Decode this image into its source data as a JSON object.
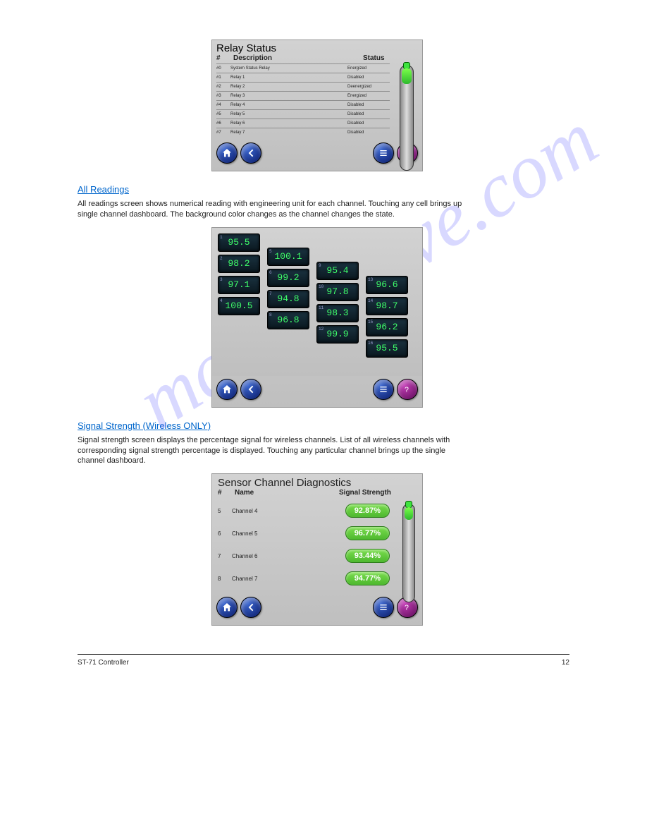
{
  "watermark": "manualslive.com",
  "relay": {
    "title": "Relay Status",
    "headers": {
      "num": "#",
      "desc": "Description",
      "status": "Status"
    },
    "rows": [
      {
        "num": "#0",
        "desc": "System Status Relay",
        "status": "Energized"
      },
      {
        "num": "#1",
        "desc": "Relay 1",
        "status": "Disabled"
      },
      {
        "num": "#2",
        "desc": "Relay 2",
        "status": "Deenergized"
      },
      {
        "num": "#3",
        "desc": "Relay 3",
        "status": "Energized"
      },
      {
        "num": "#4",
        "desc": "Relay 4",
        "status": "Disabled"
      },
      {
        "num": "#5",
        "desc": "Relay 5",
        "status": "Disabled"
      },
      {
        "num": "#6",
        "desc": "Relay 6",
        "status": "Disabled"
      },
      {
        "num": "#7",
        "desc": "Relay 7",
        "status": "Disabled"
      }
    ]
  },
  "sections": {
    "allReadings": {
      "title": "All Readings",
      "desc": "All readings screen shows numerical reading with engineering unit for each channel. Touching any cell brings up single channel dashboard. The background color changes as the channel changes the state.",
      "values": [
        {
          "id": "1",
          "v": "95.5"
        },
        {
          "id": "2",
          "v": "98.2"
        },
        {
          "id": "3",
          "v": "97.1"
        },
        {
          "id": "4",
          "v": "100.5"
        },
        {
          "id": "5",
          "v": "100.1"
        },
        {
          "id": "6",
          "v": "99.2"
        },
        {
          "id": "7",
          "v": "94.8"
        },
        {
          "id": "8",
          "v": "96.8"
        },
        {
          "id": "9",
          "v": "95.4"
        },
        {
          "id": "10",
          "v": "97.8"
        },
        {
          "id": "11",
          "v": "98.3"
        },
        {
          "id": "12",
          "v": "99.9"
        },
        {
          "id": "13",
          "v": "96.6"
        },
        {
          "id": "14",
          "v": "98.7"
        },
        {
          "id": "15",
          "v": "96.2"
        },
        {
          "id": "16",
          "v": "95.5"
        }
      ]
    },
    "diag": {
      "title1": "Signal Strength (Wireless ONLY)",
      "desc": "Signal strength screen displays the percentage signal for wireless channels. List of all wireless channels with corresponding signal strength percentage is displayed. Touching any particular channel brings up the single channel dashboard.",
      "panelTitle": "Sensor Channel Diagnostics",
      "headers": {
        "num": "#",
        "name": "Name",
        "sig": "Signal Strength"
      },
      "rows": [
        {
          "num": "5",
          "name": "Channel 4",
          "sig": "92.87%"
        },
        {
          "num": "6",
          "name": "Channel 5",
          "sig": "96.77%"
        },
        {
          "num": "7",
          "name": "Channel 6",
          "sig": "93.44%"
        },
        {
          "num": "8",
          "name": "Channel 7",
          "sig": "94.77%"
        }
      ]
    }
  },
  "footer": {
    "left": "ST-71 Controller",
    "right": "12"
  }
}
